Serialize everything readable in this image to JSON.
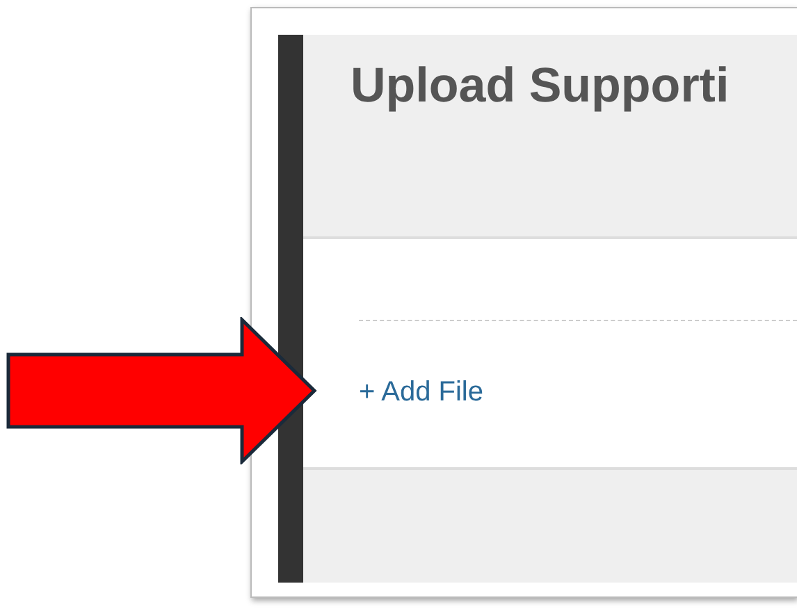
{
  "panel": {
    "title": "Upload Supporti",
    "add_file_link": "+ Add File"
  }
}
